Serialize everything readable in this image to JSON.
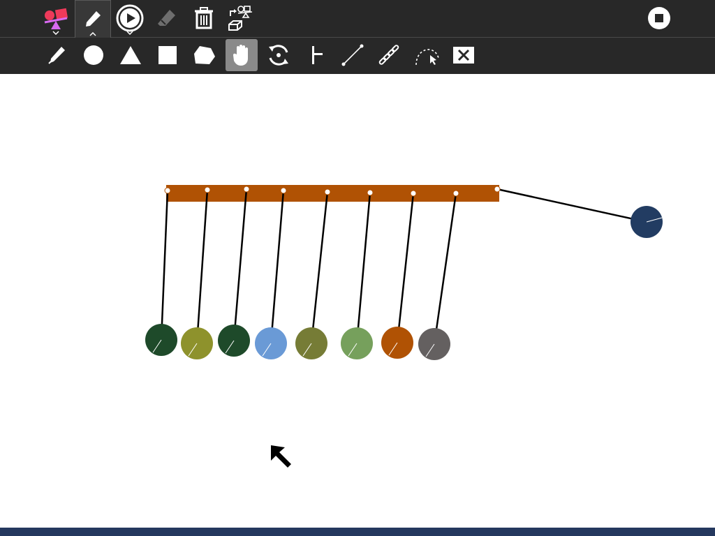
{
  "app": {
    "toolbar_top": [
      {
        "id": "activity-icon",
        "icon": "physics-activity-icon",
        "interactable": true
      },
      {
        "id": "edit-tool",
        "icon": "pencil-icon",
        "selected": true
      },
      {
        "id": "play",
        "icon": "play-icon"
      },
      {
        "id": "clear-tool",
        "icon": "eraser-icon",
        "disabled": true
      },
      {
        "id": "trash",
        "icon": "trash-icon"
      },
      {
        "id": "scene-options",
        "icon": "scene-icon"
      },
      {
        "id": "stop",
        "icon": "stop-icon"
      }
    ],
    "toolbar_sub": [
      {
        "id": "draw-tool",
        "icon": "pencil-icon"
      },
      {
        "id": "circle-tool",
        "icon": "circle-icon"
      },
      {
        "id": "triangle-tool",
        "icon": "triangle-icon"
      },
      {
        "id": "square-tool",
        "icon": "square-icon"
      },
      {
        "id": "polygon-tool",
        "icon": "pentagon-icon"
      },
      {
        "id": "grab-tool",
        "icon": "hand-icon",
        "active": true
      },
      {
        "id": "motor-tool",
        "icon": "motor-icon"
      },
      {
        "id": "pin-tool",
        "icon": "pin-icon"
      },
      {
        "id": "rope-tool",
        "icon": "rope-icon"
      },
      {
        "id": "chain-tool",
        "icon": "chain-icon"
      },
      {
        "id": "track-tool",
        "icon": "tracker-icon"
      },
      {
        "id": "delete-tool",
        "icon": "close-icon"
      }
    ],
    "colors": {
      "toolbar_bg": "#282828",
      "beam": "#b05204",
      "bottom_bar": "#24385e",
      "balls": [
        "#1e4a2a",
        "#8e922c",
        "#1e4a2a",
        "#6a9ad6",
        "#767c36",
        "#76a05c",
        "#b05204",
        "#646060"
      ],
      "swinging_ball": "#223c62"
    }
  }
}
